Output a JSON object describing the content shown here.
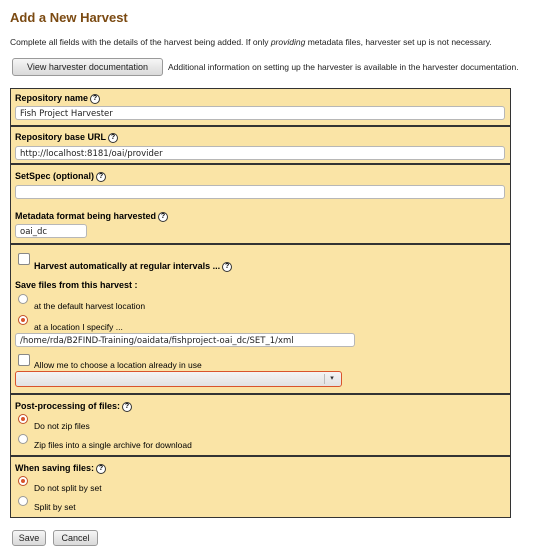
{
  "page": {
    "title": "Add a New Harvest",
    "intro_before": "Complete all fields with the details of the harvest being added. If only ",
    "intro_em": "providing",
    "intro_after": " metadata files, harvester set up is not necessary.",
    "doc_button": "View harvester documentation",
    "doc_info": "Additional information on setting up the harvester is available in the harvester documentation."
  },
  "form": {
    "repository_name": {
      "label": "Repository name",
      "value": "Fish Project Harvester"
    },
    "base_url": {
      "label": "Repository base URL",
      "value": "http://localhost:8181/oai/provider"
    },
    "setspec": {
      "label": "SetSpec (optional)",
      "value": ""
    },
    "metadata_format": {
      "label": "Metadata format being harvested",
      "value": "oai_dc"
    },
    "auto_harvest": {
      "label": "Harvest automatically at regular intervals ...",
      "checked": false
    },
    "save_files": {
      "label": "Save files from this harvest :",
      "option_default": "at the default harvest location",
      "option_specify": "at a location I specify ...",
      "selected": "specify",
      "path": "/home/rda/B2FIND-Training/oaidata/fishproject-oai_dc/SET_1/xml"
    },
    "choose_existing": {
      "label": "Allow me to choose a location already in use",
      "checked": false,
      "selected_value": ""
    },
    "post_processing": {
      "label": "Post-processing of files:",
      "option_nozip": "Do not zip files",
      "option_zip": "Zip files into a single archive for download",
      "selected": "nozip"
    },
    "when_saving": {
      "label": "When saving files:",
      "option_nosplit": "Do not split by set",
      "option_split": "Split by set",
      "selected": "nosplit"
    }
  },
  "actions": {
    "save": "Save",
    "cancel": "Cancel"
  },
  "icons": {
    "help": "?",
    "dropdown": "▾"
  },
  "colors": {
    "panel": "#fae4a6",
    "title": "#7b4a12",
    "accent": "#d9542c"
  }
}
